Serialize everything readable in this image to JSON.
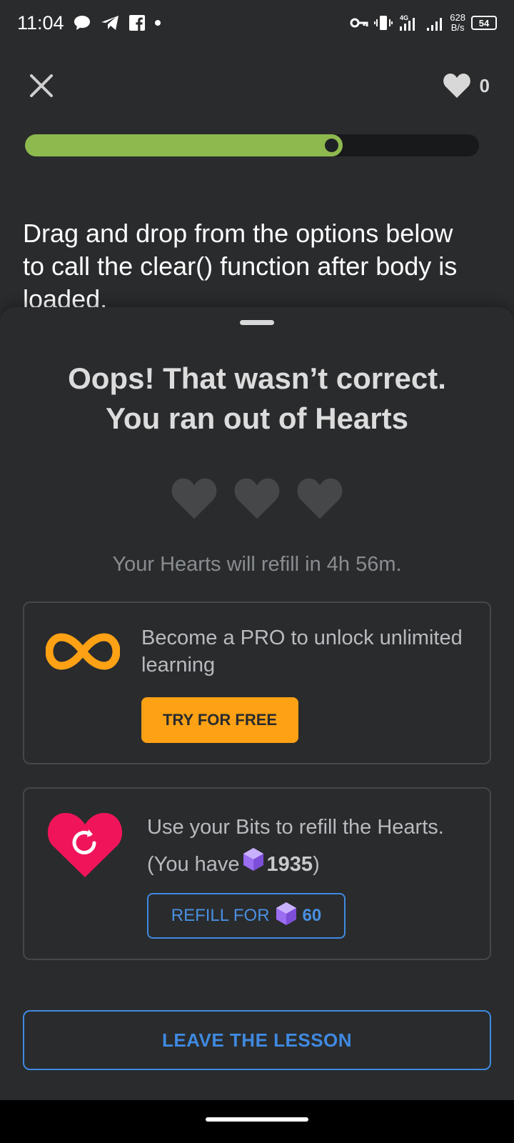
{
  "status_bar": {
    "time": "11:04",
    "icons": [
      "chat-bubble-icon",
      "telegram-icon",
      "facebook-icon",
      "dot-icon",
      "vpn-key-icon",
      "vibrate-icon",
      "4g-signal-icon",
      "signal-icon"
    ],
    "net_speed_value": "628",
    "net_speed_unit": "B/s",
    "battery": "54"
  },
  "lesson": {
    "hearts_count": "0",
    "progress_percent": 70,
    "question": "Drag and drop from the options below to call the clear() function after body is loaded."
  },
  "sheet": {
    "title_line1": "Oops! That wasn’t correct.",
    "title_line2": "You ran out of Hearts",
    "refill_timer": "Your Hearts will refill in 4h 56m.",
    "pro_card": {
      "text": "Become a PRO to unlock unlimited learning",
      "button_label": "TRY FOR FREE"
    },
    "refill_card": {
      "text_before": "Use your Bits to refill the Hearts. (You have",
      "bits_count": "1935",
      "text_after": ")",
      "button_label": "REFILL FOR",
      "button_price": "60"
    },
    "leave_button_label": "LEAVE THE LESSON"
  },
  "colors": {
    "accent_orange": "#ffa115",
    "accent_blue": "#3f8ae0",
    "progress_green": "#8db94f",
    "heart_pink": "#f0145a",
    "bits_purple": "#9b6df0"
  }
}
